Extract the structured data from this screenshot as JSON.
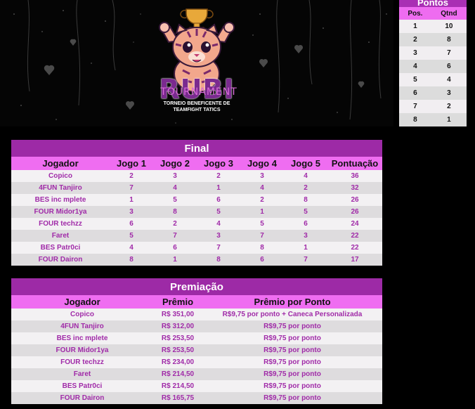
{
  "banner": {
    "logo_title": "RUBI",
    "logo_subtitle": "TOURNAMENT",
    "logo_caption_line1": "TORNEIO BENEFICENTE DE",
    "logo_caption_line2": "TEAMFIGHT TATICS"
  },
  "pontos": {
    "title": "Pontos",
    "headers": [
      "Pos.",
      "Qtnd"
    ],
    "rows": [
      [
        "1",
        "10"
      ],
      [
        "2",
        "8"
      ],
      [
        "3",
        "7"
      ],
      [
        "4",
        "6"
      ],
      [
        "5",
        "4"
      ],
      [
        "6",
        "3"
      ],
      [
        "7",
        "2"
      ],
      [
        "8",
        "1"
      ]
    ]
  },
  "final": {
    "title": "Final",
    "headers": [
      "Jogador",
      "Jogo 1",
      "Jogo 2",
      "Jogo 3",
      "Jogo 4",
      "Jogo 5",
      "Pontuação"
    ],
    "rows": [
      [
        "Copico",
        "2",
        "3",
        "2",
        "3",
        "4",
        "36"
      ],
      [
        "4FUN Tanjiro",
        "7",
        "4",
        "1",
        "4",
        "2",
        "32"
      ],
      [
        "BES inc mplete",
        "1",
        "5",
        "6",
        "2",
        "8",
        "26"
      ],
      [
        "FOUR Midor1ya",
        "3",
        "8",
        "5",
        "1",
        "5",
        "26"
      ],
      [
        "FOUR techzz",
        "6",
        "2",
        "4",
        "5",
        "6",
        "24"
      ],
      [
        "Faret",
        "5",
        "7",
        "3",
        "7",
        "3",
        "22"
      ],
      [
        "BES Patr0ci",
        "4",
        "6",
        "7",
        "8",
        "1",
        "22"
      ],
      [
        "FOUR Dairon",
        "8",
        "1",
        "8",
        "6",
        "7",
        "17"
      ]
    ]
  },
  "premiacao": {
    "title": "Premiação",
    "headers": [
      "Jogador",
      "Prêmio",
      "Prêmio por Ponto"
    ],
    "rows": [
      [
        "Copico",
        "R$ 351,00",
        "R$9,75 por ponto + Caneca Personalizada"
      ],
      [
        "4FUN Tanjiro",
        "R$ 312,00",
        "R$9,75 por ponto"
      ],
      [
        "BES inc mplete",
        "R$ 253,50",
        "R$9,75 por ponto"
      ],
      [
        "FOUR Midor1ya",
        "R$ 253,50",
        "R$9,75 por ponto"
      ],
      [
        "FOUR techzz",
        "R$ 234,00",
        "R$9,75 por ponto"
      ],
      [
        "Faret",
        "R$ 214,50",
        "R$9,75 por ponto"
      ],
      [
        "BES Patr0ci",
        "R$ 214,50",
        "R$9,75 por ponto"
      ],
      [
        "FOUR Dairon",
        "R$ 165,75",
        "R$9,75 por ponto"
      ]
    ]
  },
  "colors": {
    "title_bar": "#9d2aa6",
    "header_bar": "#ef6df1",
    "row_text": "#a02aa8",
    "row_light": "#f3f1f3",
    "row_dark": "#dedcde"
  }
}
